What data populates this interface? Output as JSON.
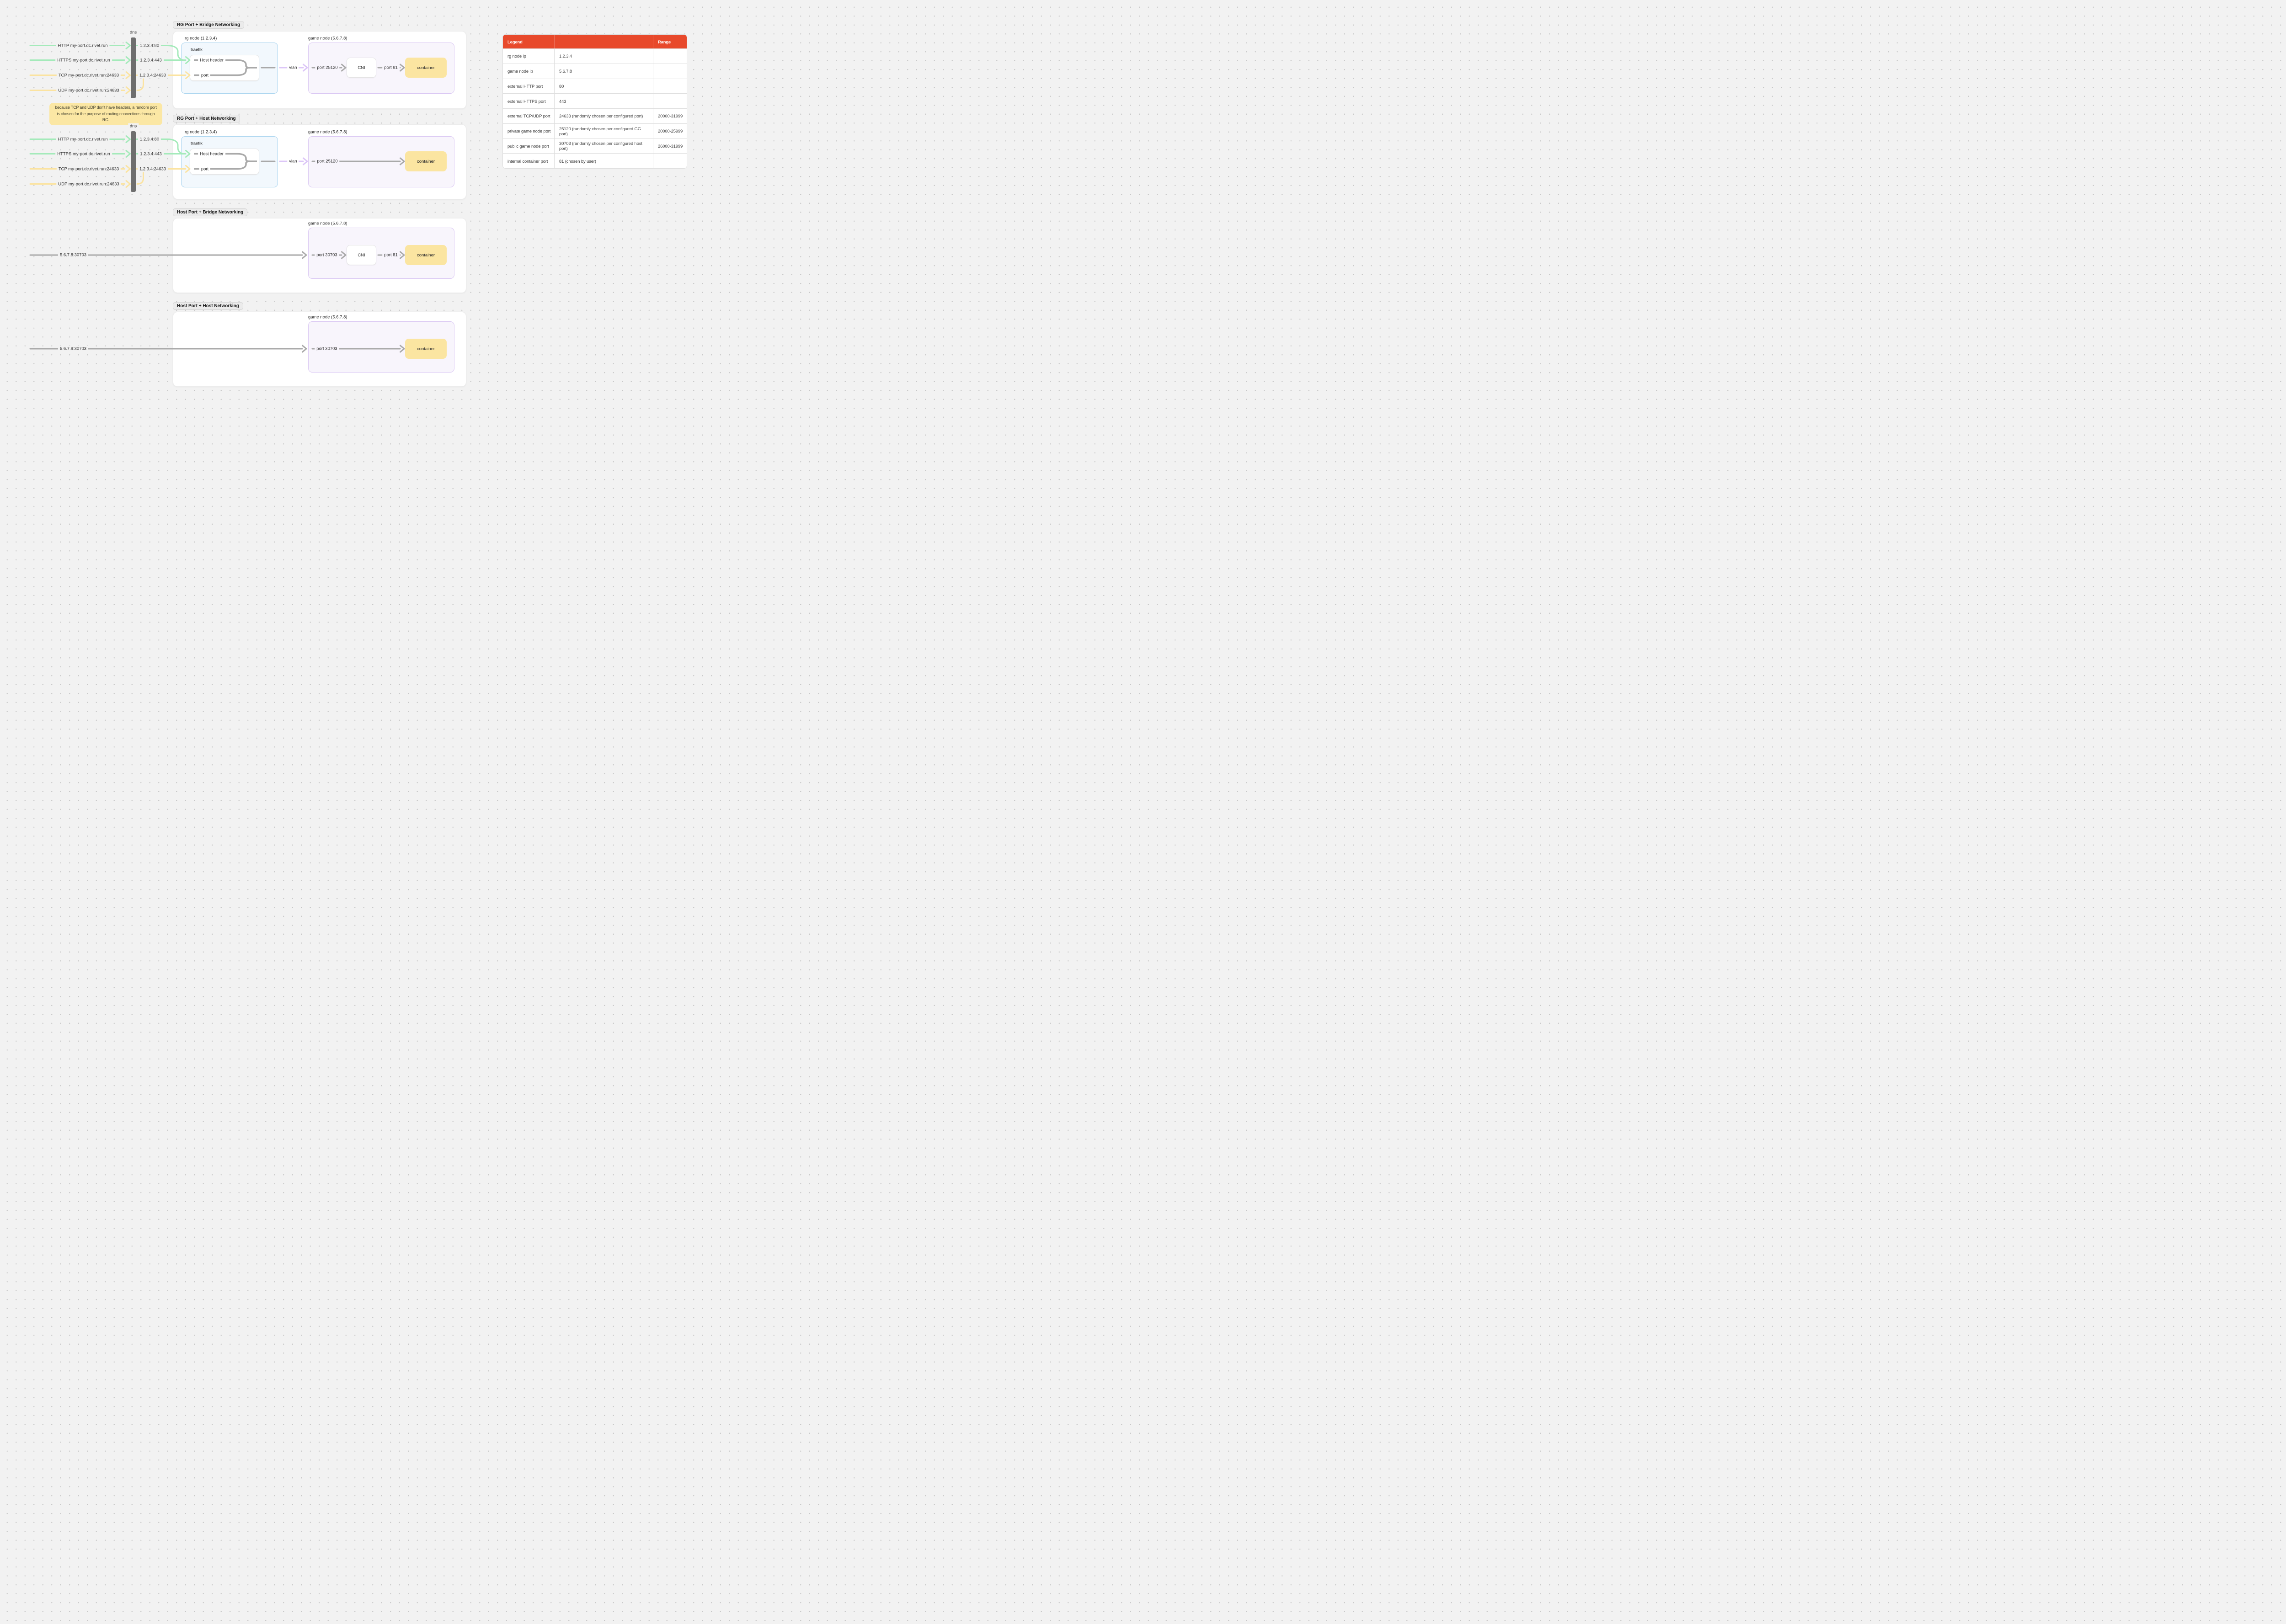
{
  "colors": {
    "background": "#f2f2f2",
    "dot": "#c7c7c7",
    "card_bg": "#ffffff",
    "card_border": "#ececec",
    "chip_bg": "#ebebeb",
    "chip_border": "#d5d5d5",
    "text": "#2d2d2d",
    "green": "#a4eaba",
    "yellow": "#fbe3a0",
    "gray_line": "#a9a9a9",
    "purple": "#dcc6f7",
    "dns_bar": "#6e6e6e",
    "rg_fill": "#f2f8fd",
    "rg_border": "#a9d4ef",
    "box_border": "#e4e4e4",
    "game_fill": "#f8f5fc",
    "game_border": "#d9c6f3",
    "container_fill": "#fbe5a1",
    "note_fill": "#fbe7a4",
    "table_header_bg": "#e8492b",
    "table_header_text": "#ffffff",
    "table_border": "#dedede",
    "table_text": "#3f3f3f"
  },
  "clusters": [
    {
      "dns": "dns",
      "rows": [
        {
          "label": "HTTP my-port.dc.rivet.run",
          "resolved": "1.2.3.4:80"
        },
        {
          "label": "HTTPS my-port.dc.rivet.run",
          "resolved": "1.2.3.4:443"
        },
        {
          "label": "TCP my-port.dc.rivet.run:24633",
          "resolved": "1.2.3.4:24633"
        },
        {
          "label": "UDP my-port.dc.rivet.run:24633",
          "resolved": ""
        }
      ]
    },
    {
      "dns": "dns",
      "rows": [
        {
          "label": "HTTP my-port.dc.rivet.run",
          "resolved": "1.2.3.4:80"
        },
        {
          "label": "HTTPS my-port.dc.rivet.run",
          "resolved": "1.2.3.4:443"
        },
        {
          "label": "TCP my-port.dc.rivet.run:24633",
          "resolved": "1.2.3.4:24633"
        },
        {
          "label": "UDP my-port.dc.rivet.run:24633",
          "resolved": ""
        }
      ]
    }
  ],
  "note": {
    "text": "because TCP and UDP don’t have headers, a random port is chosen for the purpose of routing connections through RG."
  },
  "sections": [
    {
      "title": "RG Port + Bridge Networking",
      "rg_node": "rg node (1.2.3.4)",
      "traefik": "traefik",
      "host_header": "Host header",
      "port": "port",
      "vlan": "vlan",
      "game_node": "game node (5.6.7.8)",
      "ingress_port": "port 25120",
      "cni": "CNI",
      "egress_port": "port 81",
      "container": "container"
    },
    {
      "title": "RG Port + Host Networking",
      "rg_node": "rg node (1.2.3.4)",
      "traefik": "traefik",
      "host_header": "Host header",
      "port": "port",
      "vlan": "vlan",
      "game_node": "game node (5.6.7.8)",
      "ingress_port": "port 25120",
      "container": "container"
    },
    {
      "title": "Host Port + Bridge Networking",
      "external": "5.6.7.8:30703",
      "game_node": "game node (5.6.7.8)",
      "ingress_port": "port 30703",
      "cni": "CNI",
      "egress_port": "port 81",
      "container": "container"
    },
    {
      "title": "Host Port + Host Networking",
      "external": "5.6.7.8:30703",
      "game_node": "game node (5.6.7.8)",
      "ingress_port": "port 30703",
      "container": "container"
    }
  ],
  "legend_table": {
    "headers": [
      "Legend",
      "",
      "Range"
    ],
    "rows": [
      [
        "rg node ip",
        "1.2.3.4",
        ""
      ],
      [
        "game node ip",
        "5.6.7.8",
        ""
      ],
      [
        "external HTTP port",
        "80",
        ""
      ],
      [
        "external HTTPS port",
        "443",
        ""
      ],
      [
        "external TCP/UDP port",
        "24633 (randomly chosen per configured port)",
        "20000-31999"
      ],
      [
        "private game node port",
        "25120 (randomly chosen per configured GG port)",
        "20000-25999"
      ],
      [
        "public game node port",
        "30703 (randomly chosen per configured host port)",
        "26000-31999"
      ],
      [
        "internal container port",
        "81 (chosen by user)",
        ""
      ]
    ]
  }
}
